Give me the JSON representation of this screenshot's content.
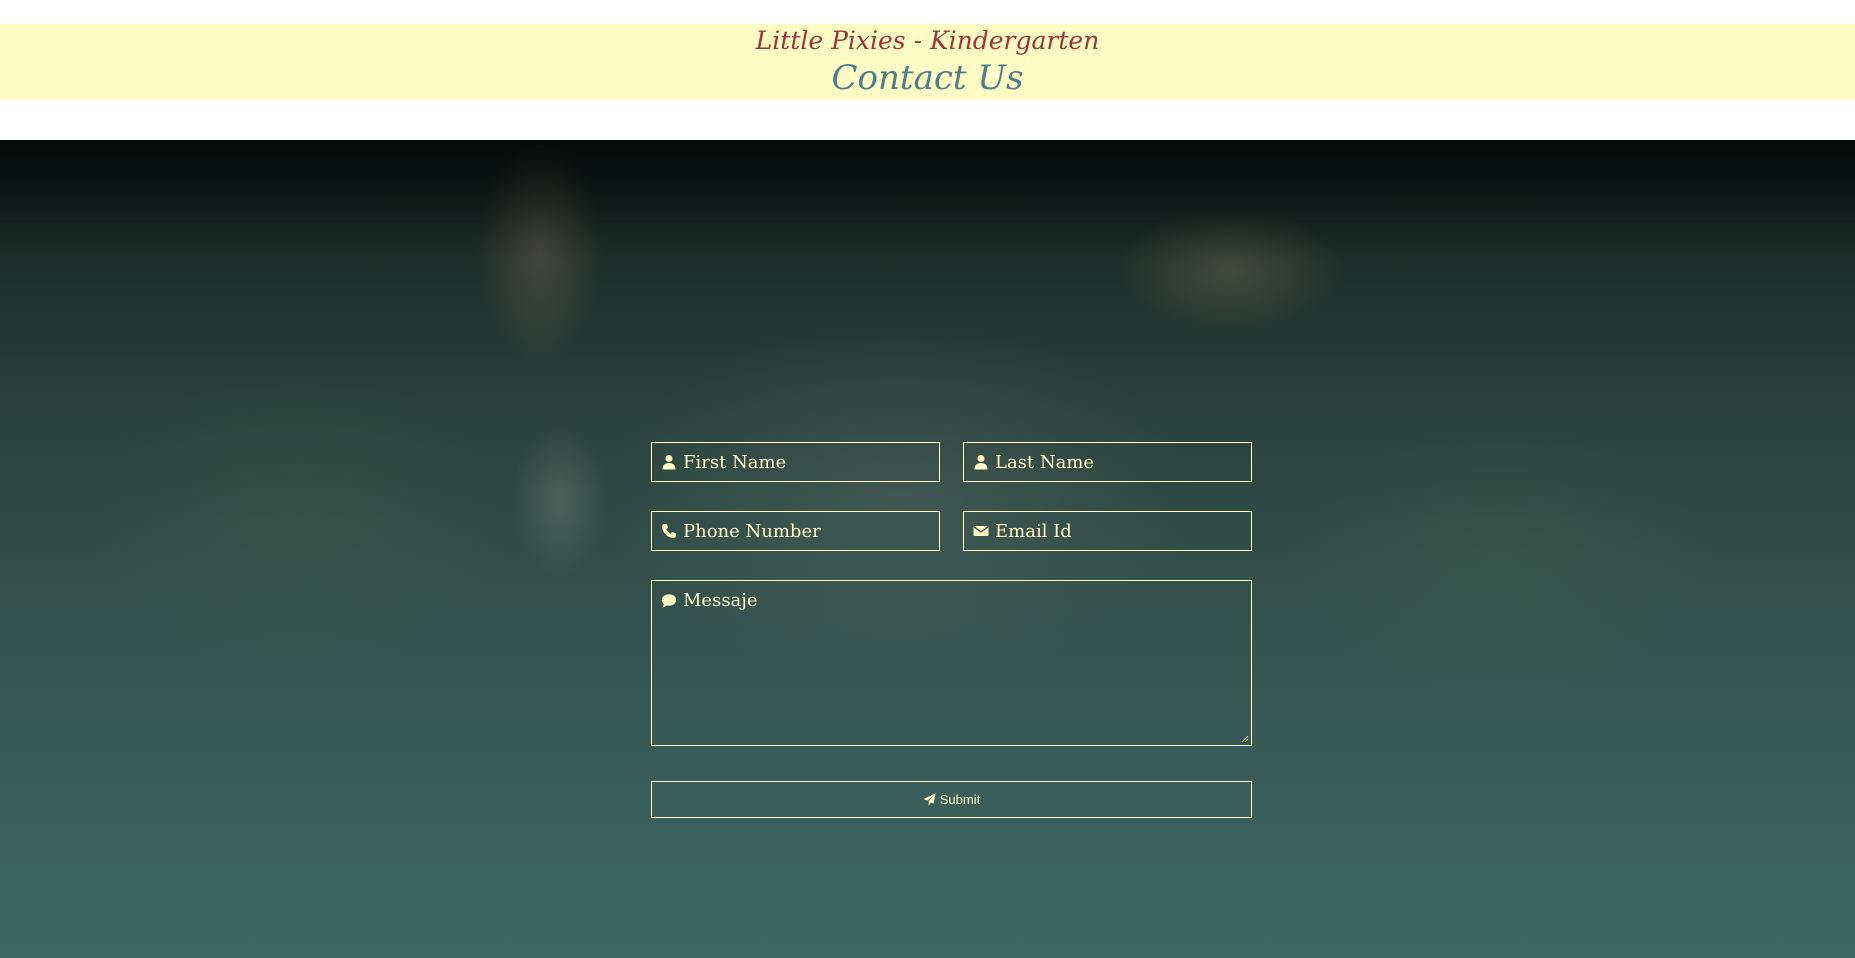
{
  "header": {
    "brand": "Little Pixies - Kindergarten",
    "title": "Contact Us"
  },
  "form": {
    "first_name": {
      "placeholder": "First Name",
      "icon": "user-icon"
    },
    "last_name": {
      "placeholder": "Last Name",
      "icon": "user-icon"
    },
    "phone": {
      "placeholder": "Phone Number",
      "icon": "phone-icon"
    },
    "email": {
      "placeholder": "Email Id",
      "icon": "envelope-icon"
    },
    "message": {
      "placeholder": "Messaje",
      "icon": "comment-icon"
    },
    "submit": {
      "label": "Submit",
      "icon": "paper-plane-icon"
    }
  },
  "colors": {
    "header_band": "#fffcc6",
    "brand_text": "#a0343a",
    "title_text": "#4f7d88",
    "form_accent": "#fffcc6"
  }
}
